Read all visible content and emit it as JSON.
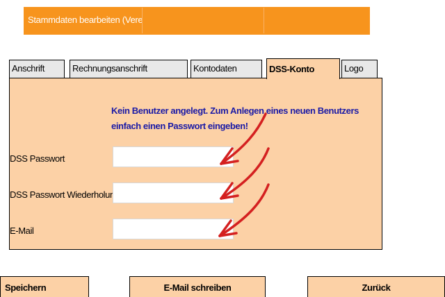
{
  "header": {
    "title": "Stammdaten  bearbeiten (Verein:",
    "verein_value": ""
  },
  "tabs": [
    {
      "label": "Anschrift",
      "active": false
    },
    {
      "label": "Rechnungsanschrift",
      "active": false
    },
    {
      "label": "Kontodaten",
      "active": false
    },
    {
      "label": "DSS-Konto",
      "active": true
    },
    {
      "label": "Logo",
      "active": false
    }
  ],
  "panel": {
    "notice": "Kein Benutzer angelegt. Zum Anlegen eines neuen Benutzers einfach einen Passwort eingeben!",
    "fields": [
      {
        "label": "DSS Passwort",
        "value": ""
      },
      {
        "label": "DSS Passwort Wiederholung",
        "value": ""
      },
      {
        "label": "E-Mail",
        "value": ""
      }
    ]
  },
  "buttons": {
    "save": "Speichern",
    "email": "E-Mail schreiben",
    "back": "Zurück"
  },
  "colors": {
    "title_bar": "#f7941d",
    "panel": "#fcd1a6",
    "notice_text": "#1a1aa6",
    "arrow": "#d42020"
  },
  "annotation": {
    "arrows": [
      "red-arrow-icon",
      "red-arrow-icon",
      "red-arrow-icon"
    ]
  }
}
